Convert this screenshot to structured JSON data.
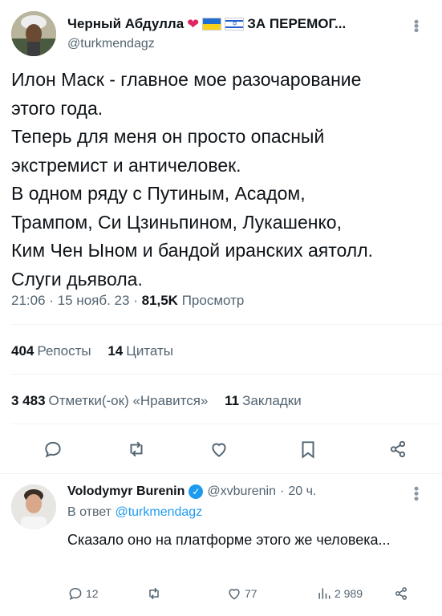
{
  "post": {
    "author_name": "Черный Абдулла",
    "author_name_suffix": "ЗА ПЕРЕМОГ...",
    "author_handle": "@turkmendagz",
    "text": "Илон Маск - главное мое разочарование\nэтого года.\nТеперь для меня он просто опасный\nэкстремист и античеловек.\nВ одном ряду с Путиным, Асадом,\nТрампом, Си Цзиньпином, Лукашенко,\nКим Чен Ыном и бандой иранских аятолл.\nСлуги дьявола.",
    "time": "21:06",
    "date": "15 нояб. 23",
    "views": "81,5K",
    "views_label": "Просмотр",
    "reposts_count": "404",
    "reposts_label": "Репосты",
    "quotes_count": "14",
    "quotes_label": "Цитаты",
    "likes_count": "3 483",
    "likes_label": "Отметки(-ок) «Нравится»",
    "bookmarks_count": "11",
    "bookmarks_label": "Закладки"
  },
  "reply": {
    "author_name": "Volodymyr Burenin",
    "author_handle": "@xvburenin",
    "time_ago": "20 ч.",
    "reply_to_label": "В ответ",
    "reply_to_handle": "@turkmendagz",
    "text": "Сказало оно на платформе этого же человека...",
    "replies": "12",
    "likes": "77",
    "views": "2 989"
  },
  "colors": {
    "text": "#0f1419",
    "secondary": "#536471",
    "accent": "#1d9bf0",
    "heart": "#e0245e"
  },
  "icons": [
    "heart-icon",
    "ukraine-flag-icon",
    "israel-flag-icon",
    "more-icon",
    "reply-icon",
    "retweet-icon",
    "like-icon",
    "bookmark-icon",
    "share-icon",
    "verified-icon",
    "views-icon"
  ]
}
